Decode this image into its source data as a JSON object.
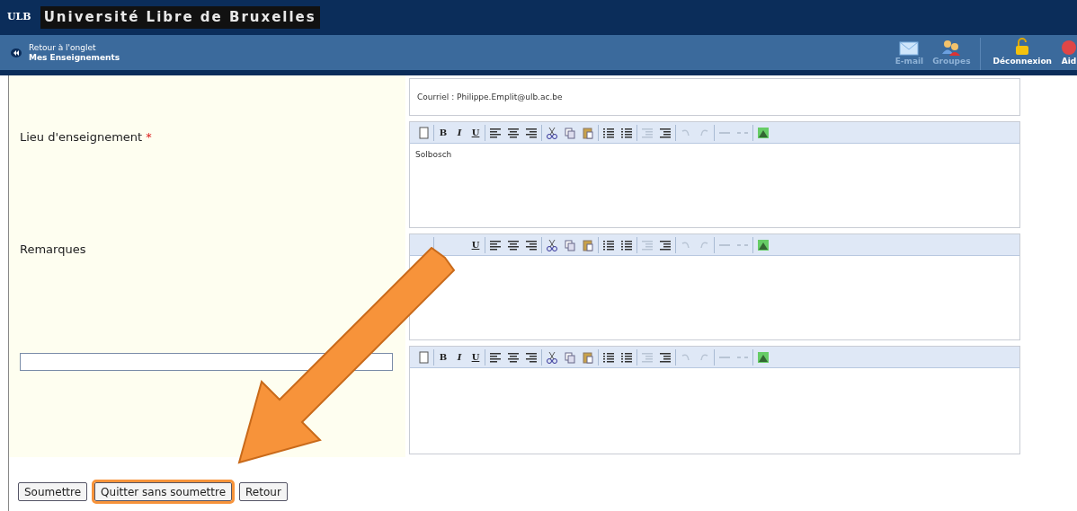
{
  "header": {
    "logo": "ULB",
    "title": "Université Libre de Bruxelles"
  },
  "navbar": {
    "back_line1": "Retour à l'onglet",
    "back_line2": "Mes Enseignements",
    "actions": [
      {
        "kind": "email",
        "label": "E-mail",
        "disabled": true
      },
      {
        "kind": "groups",
        "label": "Groupes",
        "disabled": true
      },
      {
        "kind": "logout",
        "label": "Déconnexion",
        "disabled": false
      },
      {
        "kind": "help",
        "label": "Aid",
        "disabled": false
      }
    ]
  },
  "form": {
    "rows": [
      {
        "kind": "text",
        "value": "Courriel : Philippe.Emplit@ulb.ac.be"
      },
      {
        "kind": "editor",
        "label": "Lieu d'enseignement",
        "required_mark": "*",
        "value": "Solbosch",
        "toolbar": [
          "B",
          "I",
          "U"
        ]
      },
      {
        "kind": "editor",
        "label": "Remarques",
        "toolbar": [
          "U"
        ]
      },
      {
        "kind": "editor_input",
        "toolbar": [
          "B",
          "I",
          "U"
        ]
      }
    ],
    "buttons": [
      {
        "label": "Soumettre",
        "highlighted": false
      },
      {
        "label": "Quitter sans soumettre",
        "highlighted": true
      },
      {
        "label": "Retour",
        "highlighted": false
      }
    ]
  }
}
